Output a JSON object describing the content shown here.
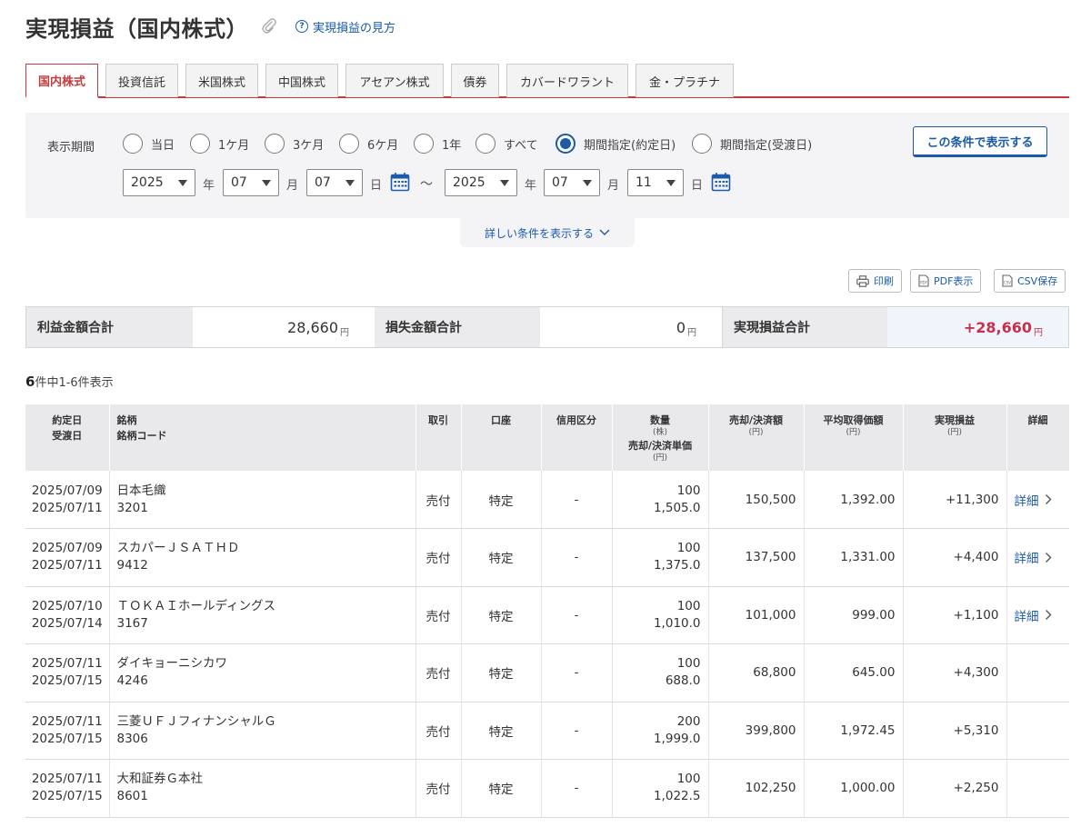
{
  "header": {
    "title": "実現損益（国内株式）",
    "help_link": "実現損益の見方",
    "help_icon_char": "?"
  },
  "tabs": [
    {
      "label": "国内株式",
      "active": true
    },
    {
      "label": "投資信託",
      "active": false
    },
    {
      "label": "米国株式",
      "active": false
    },
    {
      "label": "中国株式",
      "active": false
    },
    {
      "label": "アセアン株式",
      "active": false
    },
    {
      "label": "債券",
      "active": false
    },
    {
      "label": "カバードワラント",
      "active": false
    },
    {
      "label": "金・プラチナ",
      "active": false
    }
  ],
  "filter": {
    "period_label": "表示期間",
    "options": [
      {
        "label": "当日",
        "checked": false
      },
      {
        "label": "1ケ月",
        "checked": false
      },
      {
        "label": "3ケ月",
        "checked": false
      },
      {
        "label": "6ケ月",
        "checked": false
      },
      {
        "label": "1年",
        "checked": false
      },
      {
        "label": "すべて",
        "checked": false
      },
      {
        "label": "期間指定(約定日)",
        "checked": true
      },
      {
        "label": "期間指定(受渡日)",
        "checked": false
      }
    ],
    "show_button": "この条件で表示する",
    "from": {
      "year": "2025",
      "month": "07",
      "day": "07"
    },
    "to": {
      "year": "2025",
      "month": "07",
      "day": "11"
    },
    "unit_year": "年",
    "unit_month": "月",
    "unit_day": "日",
    "range_sep": "～",
    "detail_toggle": "詳しい条件を表示する"
  },
  "export": {
    "print": "印刷",
    "pdf": "PDF表示",
    "csv": "CSV保存",
    "pdf_icon_text": "PDF",
    "csv_icon_text": "CSV"
  },
  "summary": {
    "profit_label": "利益金額合計",
    "profit_value": "28,660",
    "loss_label": "損失金額合計",
    "loss_value": "0",
    "realized_label": "実現損益合計",
    "realized_value": "+28,660",
    "yen": "円"
  },
  "count": {
    "total": "6",
    "text": "件中1-6件表示"
  },
  "table": {
    "headers": {
      "date1": "約定日",
      "date2": "受渡日",
      "name1": "銘柄",
      "name2": "銘柄コード",
      "trade": "取引",
      "account": "口座",
      "credit": "信用区分",
      "qty": "数量",
      "qty_unit": "(株)",
      "price": "売却/決済単価",
      "price_unit": "(円)",
      "amount": "売却/決済額",
      "amount_unit": "(円)",
      "avg": "平均取得価額",
      "avg_unit": "(円)",
      "pl": "実現損益",
      "pl_unit": "(円)",
      "detail": "詳細"
    },
    "rows": [
      {
        "trade_date": "2025/07/09",
        "settle_date": "2025/07/11",
        "name": "日本毛織",
        "code": "3201",
        "trade": "売付",
        "account": "特定",
        "credit": "-",
        "qty": "100",
        "price": "1,505.0",
        "amount": "150,500",
        "avg": "1,392.00",
        "pl": "+11,300",
        "detail": "詳細"
      },
      {
        "trade_date": "2025/07/09",
        "settle_date": "2025/07/11",
        "name": "スカパーＪＳＡＴＨＤ",
        "code": "9412",
        "trade": "売付",
        "account": "特定",
        "credit": "-",
        "qty": "100",
        "price": "1,375.0",
        "amount": "137,500",
        "avg": "1,331.00",
        "pl": "+4,400",
        "detail": "詳細"
      },
      {
        "trade_date": "2025/07/10",
        "settle_date": "2025/07/14",
        "name": "ＴＯＫＡＩホールディングス",
        "code": "3167",
        "trade": "売付",
        "account": "特定",
        "credit": "-",
        "qty": "100",
        "price": "1,010.0",
        "amount": "101,000",
        "avg": "999.00",
        "pl": "+1,100",
        "detail": "詳細"
      },
      {
        "trade_date": "2025/07/11",
        "settle_date": "2025/07/15",
        "name": "ダイキョーニシカワ",
        "code": "4246",
        "trade": "売付",
        "account": "特定",
        "credit": "-",
        "qty": "100",
        "price": "688.0",
        "amount": "68,800",
        "avg": "645.00",
        "pl": "+4,300",
        "detail": ""
      },
      {
        "trade_date": "2025/07/11",
        "settle_date": "2025/07/15",
        "name": "三菱ＵＦＪフィナンシャルＧ",
        "code": "8306",
        "trade": "売付",
        "account": "特定",
        "credit": "-",
        "qty": "200",
        "price": "1,999.0",
        "amount": "399,800",
        "avg": "1,972.45",
        "pl": "+5,310",
        "detail": ""
      },
      {
        "trade_date": "2025/07/11",
        "settle_date": "2025/07/15",
        "name": "大和証券Ｇ本社",
        "code": "8601",
        "trade": "売付",
        "account": "特定",
        "credit": "-",
        "qty": "100",
        "price": "1,022.5",
        "amount": "102,250",
        "avg": "1,000.00",
        "pl": "+2,250",
        "detail": ""
      }
    ]
  },
  "colors": {
    "accent": "#1a5aa8",
    "active_tab": "#c33c3c",
    "profit": "#c8304a",
    "panel_bg": "#f4f4f6",
    "header_bg": "#e9e9ec"
  }
}
